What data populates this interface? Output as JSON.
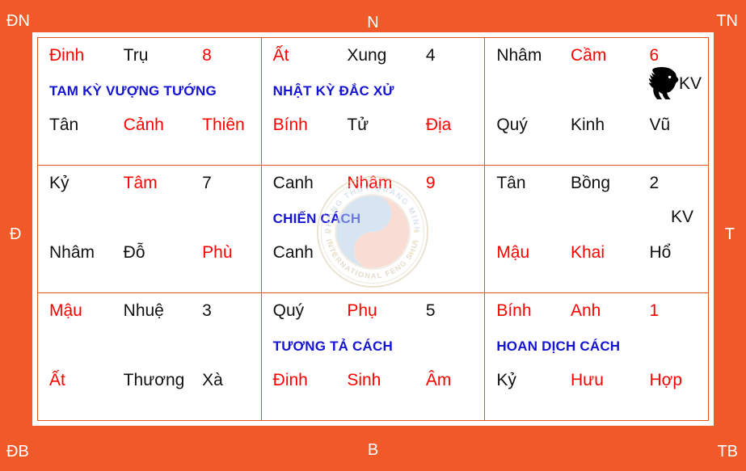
{
  "directions": {
    "nw": "ĐN",
    "n": "N",
    "ne": "TN",
    "w": "Đ",
    "e": "T",
    "sw": "ĐB",
    "s": "B",
    "se": "TB"
  },
  "colors": {
    "frame": "#EF5A28",
    "grid_line": "#E2551C",
    "red_text": "#FF0000",
    "black_text": "#111111",
    "blue_text": "#1414D2",
    "paper": "#FFFFFF"
  },
  "watermark": {
    "outer_text": "PHONG THỦY QUANG MINH",
    "inner_text": "INTERNATIONAL FENG SHUI",
    "symbol": "yin-yang"
  },
  "palaces": [
    {
      "position": "top-left",
      "top": [
        {
          "text": "Đinh",
          "color": "red"
        },
        {
          "text": "Trụ",
          "color": "black"
        },
        {
          "text": "8",
          "color": "red"
        }
      ],
      "title": "TAM KỲ VƯỢNG TƯỚNG",
      "bottom": [
        {
          "text": "Tân",
          "color": "black"
        },
        {
          "text": "Cảnh",
          "color": "red"
        },
        {
          "text": "Thiên",
          "color": "red"
        }
      ],
      "marker": null
    },
    {
      "position": "top-center",
      "top": [
        {
          "text": "Ất",
          "color": "red"
        },
        {
          "text": "Xung",
          "color": "black"
        },
        {
          "text": "4",
          "color": "black"
        }
      ],
      "title": "NHẬT KỲ ĐẮC XỬ",
      "bottom": [
        {
          "text": "Bính",
          "color": "red"
        },
        {
          "text": "Tử",
          "color": "black"
        },
        {
          "text": "Địa",
          "color": "red"
        }
      ],
      "marker": null
    },
    {
      "position": "top-right",
      "top": [
        {
          "text": "Nhâm",
          "color": "black"
        },
        {
          "text": "Cầm",
          "color": "red"
        },
        {
          "text": "6",
          "color": "red"
        }
      ],
      "title": "",
      "bottom": [
        {
          "text": "Quý",
          "color": "black"
        },
        {
          "text": "Kinh",
          "color": "black"
        },
        {
          "text": "Vũ",
          "color": "black"
        }
      ],
      "marker": {
        "type": "horse-kv",
        "label": "KV"
      }
    },
    {
      "position": "middle-left",
      "top": [
        {
          "text": "Kỷ",
          "color": "black"
        },
        {
          "text": "Tâm",
          "color": "red"
        },
        {
          "text": "7",
          "color": "black"
        }
      ],
      "title": "",
      "bottom": [
        {
          "text": "Nhâm",
          "color": "black"
        },
        {
          "text": "Đỗ",
          "color": "black"
        },
        {
          "text": "Phù",
          "color": "red"
        }
      ],
      "marker": null
    },
    {
      "position": "center",
      "top": [
        {
          "text": "Canh",
          "color": "black"
        },
        {
          "text": "Nhâm",
          "color": "red"
        },
        {
          "text": "9",
          "color": "red"
        }
      ],
      "title": "CHIẾN CÁCH",
      "bottom": [
        {
          "text": "Canh",
          "color": "black"
        },
        {
          "text": "",
          "color": "black"
        },
        {
          "text": "",
          "color": "black"
        }
      ],
      "marker": null
    },
    {
      "position": "middle-right",
      "top": [
        {
          "text": "Tân",
          "color": "black"
        },
        {
          "text": "Bồng",
          "color": "black"
        },
        {
          "text": "2",
          "color": "black"
        }
      ],
      "title": "",
      "bottom": [
        {
          "text": "Mậu",
          "color": "red"
        },
        {
          "text": "Khai",
          "color": "red"
        },
        {
          "text": "Hổ",
          "color": "black"
        }
      ],
      "marker": {
        "type": "kv-plain",
        "label": "KV"
      }
    },
    {
      "position": "bottom-left",
      "top": [
        {
          "text": "Mậu",
          "color": "red"
        },
        {
          "text": "Nhuệ",
          "color": "black"
        },
        {
          "text": "3",
          "color": "black"
        }
      ],
      "title": "",
      "bottom": [
        {
          "text": "Ất",
          "color": "red"
        },
        {
          "text": "Thương",
          "color": "black"
        },
        {
          "text": "Xà",
          "color": "black"
        }
      ],
      "marker": null
    },
    {
      "position": "bottom-center",
      "top": [
        {
          "text": "Quý",
          "color": "black"
        },
        {
          "text": "Phụ",
          "color": "red"
        },
        {
          "text": "5",
          "color": "black"
        }
      ],
      "title": "TƯƠNG TẢ CÁCH",
      "bottom": [
        {
          "text": "Đinh",
          "color": "red"
        },
        {
          "text": "Sinh",
          "color": "red"
        },
        {
          "text": "Âm",
          "color": "red"
        }
      ],
      "marker": null
    },
    {
      "position": "bottom-right",
      "top": [
        {
          "text": "Bính",
          "color": "red"
        },
        {
          "text": "Anh",
          "color": "red"
        },
        {
          "text": "1",
          "color": "red"
        }
      ],
      "title": "HOAN DỊCH CÁCH",
      "bottom": [
        {
          "text": "Kỷ",
          "color": "black"
        },
        {
          "text": "Hưu",
          "color": "red"
        },
        {
          "text": "Hợp",
          "color": "red"
        }
      ],
      "marker": null
    }
  ]
}
